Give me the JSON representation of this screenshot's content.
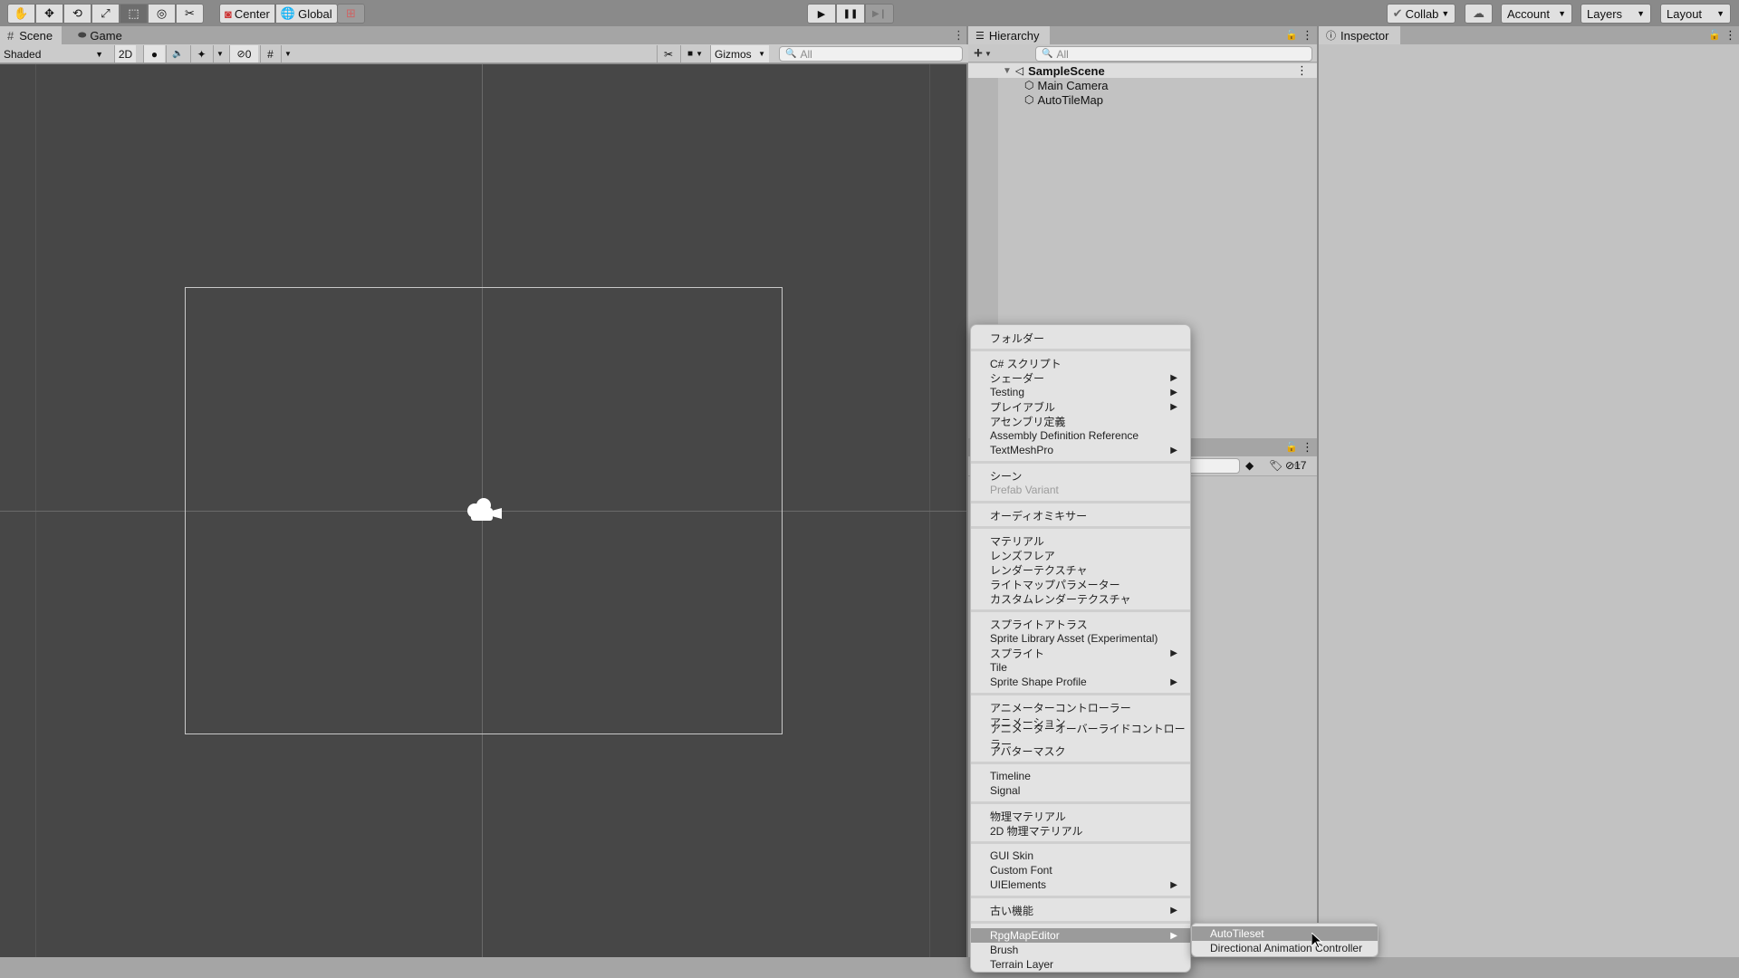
{
  "toolbar": {
    "tools": [
      {
        "name": "hand-tool",
        "icon": "✋"
      },
      {
        "name": "move-tool",
        "icon": "✥"
      },
      {
        "name": "rotate-tool",
        "icon": "⟲"
      },
      {
        "name": "scale-tool",
        "icon": "⤢"
      },
      {
        "name": "rect-tool",
        "icon": "⬚"
      },
      {
        "name": "transform-tool",
        "icon": "◎"
      },
      {
        "name": "custom-tool",
        "icon": "✂"
      }
    ],
    "pivot_label": "Center",
    "space_label": "Global",
    "snap_icon": "⊞",
    "play_icon": "▶",
    "pause_icon": "❚❚",
    "step_icon": "▶❙",
    "collab_label": "Collab",
    "cloud_icon": "☁",
    "account_label": "Account",
    "layers_label": "Layers",
    "layout_label": "Layout",
    "dropdown_arrow": "▼"
  },
  "scene_panel": {
    "tabs": [
      {
        "icon": "#",
        "label": "Scene"
      },
      {
        "icon": "🎮",
        "label": "Game"
      }
    ],
    "menu_icon": "⋮",
    "draw_mode": "Shaded",
    "mode_2d": "2D",
    "lighting_icon": "●",
    "audio_icon": "🔈",
    "effects_icon": "✦",
    "hidden_count": "0",
    "grid_icon": "#",
    "tools_icon": "✂",
    "camera_icon": "■",
    "gizmos_label": "Gizmos",
    "search_placeholder": "All"
  },
  "hierarchy": {
    "tab_label": "Hierarchy",
    "add_icon": "+",
    "search_placeholder": "All",
    "scene_name": "SampleScene",
    "objects": [
      "Main Camera",
      "AutoTileMap"
    ]
  },
  "inspector": {
    "tab_label": "Inspector"
  },
  "project": {
    "hidden_count": "17"
  },
  "context_menu": {
    "groups": [
      [
        {
          "label": "フォルダー"
        }
      ],
      [
        {
          "label": "C# スクリプト"
        },
        {
          "label": "シェーダー",
          "submenu": true
        },
        {
          "label": "Testing",
          "submenu": true
        },
        {
          "label": "プレイアブル",
          "submenu": true
        },
        {
          "label": "アセンブリ定義"
        },
        {
          "label": "Assembly Definition Reference"
        },
        {
          "label": "TextMeshPro",
          "submenu": true
        }
      ],
      [
        {
          "label": "シーン"
        },
        {
          "label": "Prefab Variant",
          "disabled": true
        }
      ],
      [
        {
          "label": "オーディオミキサー"
        }
      ],
      [
        {
          "label": "マテリアル"
        },
        {
          "label": "レンズフレア"
        },
        {
          "label": "レンダーテクスチャ"
        },
        {
          "label": "ライトマップパラメーター"
        },
        {
          "label": "カスタムレンダーテクスチャ"
        }
      ],
      [
        {
          "label": "スプライトアトラス"
        },
        {
          "label": "Sprite Library Asset (Experimental)"
        },
        {
          "label": "スプライト",
          "submenu": true
        },
        {
          "label": "Tile"
        },
        {
          "label": "Sprite Shape Profile",
          "submenu": true
        }
      ],
      [
        {
          "label": "アニメーターコントローラー"
        },
        {
          "label": "アニメーション"
        },
        {
          "label": "アニメーターオーバーライドコントローラー"
        },
        {
          "label": "アバターマスク"
        }
      ],
      [
        {
          "label": "Timeline"
        },
        {
          "label": "Signal"
        }
      ],
      [
        {
          "label": "物理マテリアル"
        },
        {
          "label": "2D 物理マテリアル"
        }
      ],
      [
        {
          "label": "GUI Skin"
        },
        {
          "label": "Custom Font"
        },
        {
          "label": "UIElements",
          "submenu": true
        }
      ],
      [
        {
          "label": "古い機能",
          "submenu": true
        }
      ],
      [
        {
          "label": "RpgMapEditor",
          "submenu": true,
          "highlighted": true
        },
        {
          "label": "Brush"
        },
        {
          "label": "Terrain Layer"
        }
      ]
    ],
    "submenu_arrow": "▶"
  },
  "submenu": {
    "items": [
      {
        "label": "AutoTileset",
        "highlighted": true
      },
      {
        "label": "Directional Animation Controller"
      }
    ]
  }
}
